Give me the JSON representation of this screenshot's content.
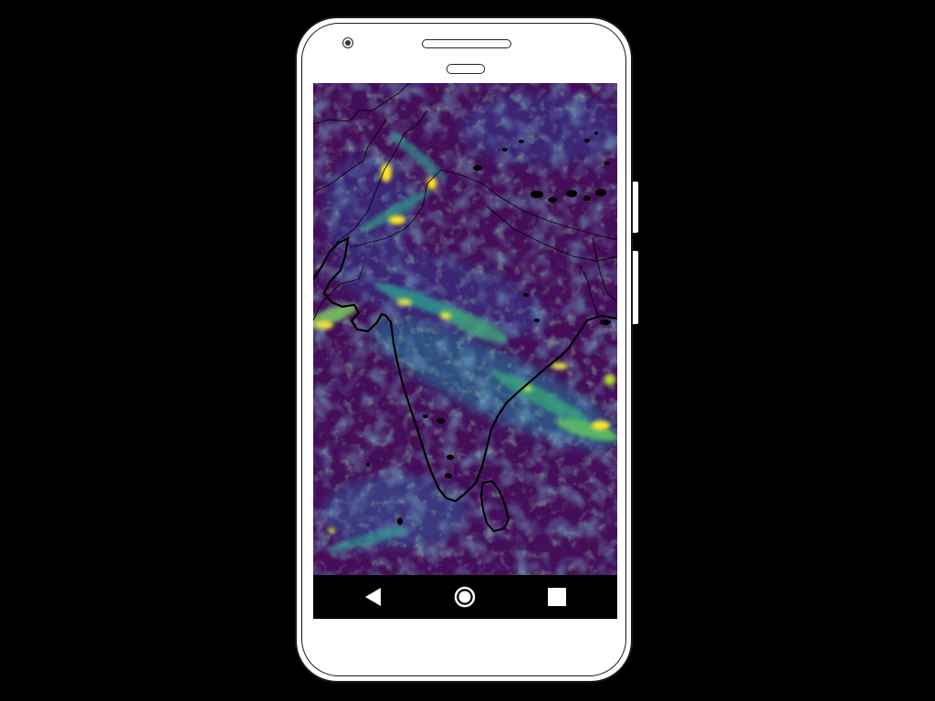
{
  "device": {
    "frame_color": "#ffffff",
    "outline_color": "#1a1a1a"
  },
  "map": {
    "colormap": "viridis",
    "background_color": "#440e5a",
    "low_color": "#3b2a7a",
    "mid_color": "#2e6d8e",
    "high_color": "#59c864",
    "peak_color": "#fde725",
    "border_color": "#000000",
    "region": "Indian subcontinent",
    "features": [
      "country-borders",
      "coastline",
      "sri-lanka"
    ]
  },
  "nav_bar": {
    "background": "#000000",
    "icon_color": "#ffffff",
    "back": {
      "icon": "triangle-left-icon"
    },
    "home": {
      "icon": "circle-home-icon"
    },
    "recents": {
      "icon": "square-recents-icon"
    }
  }
}
